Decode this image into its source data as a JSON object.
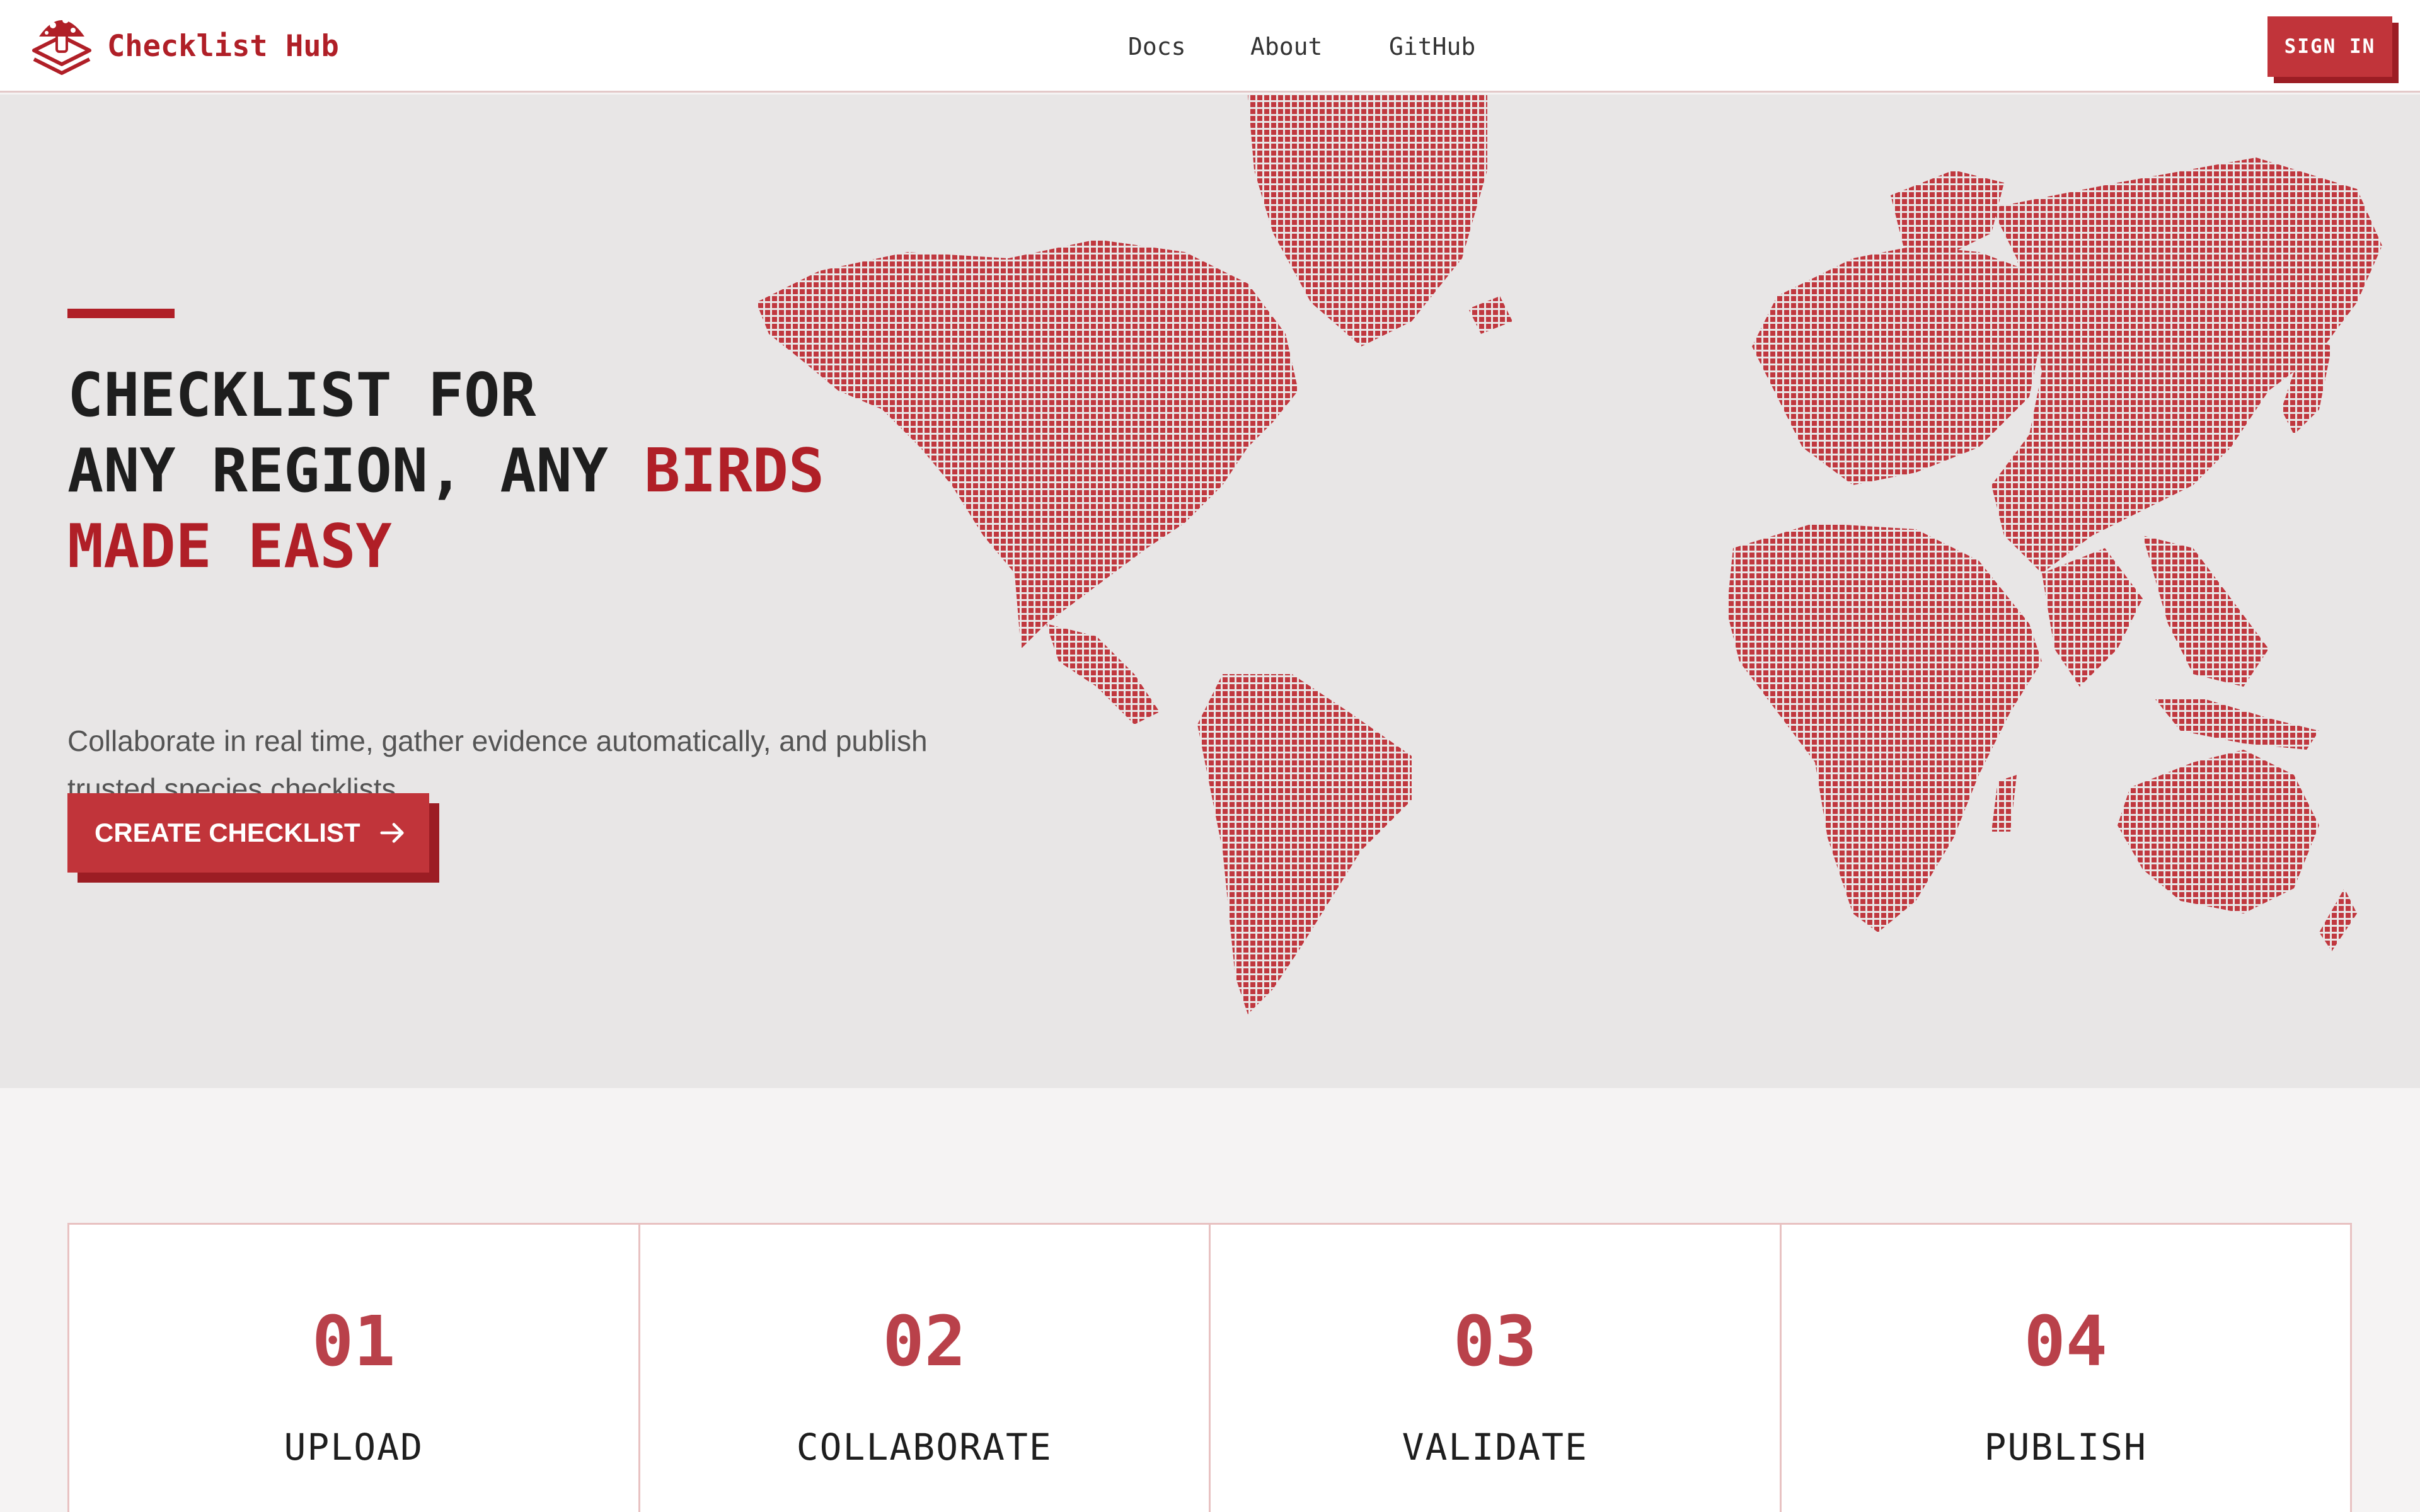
{
  "header": {
    "brand": "Checklist Hub",
    "nav": [
      {
        "label": "Docs"
      },
      {
        "label": "About"
      },
      {
        "label": "GitHub"
      }
    ],
    "signin_label": "SIGN IN"
  },
  "hero": {
    "headline_line1": "CHECKLIST FOR",
    "headline_line2_plain": "ANY REGION, ANY ",
    "headline_line2_accent": "BIRDS",
    "headline_line3": "MADE EASY",
    "subtitle": "Collaborate in real time, gather evidence automatically, and publish trusted species checklists.",
    "cta_label": "CREATE CHECKLIST"
  },
  "steps": [
    {
      "number": "01",
      "label": "UPLOAD"
    },
    {
      "number": "02",
      "label": "COLLABORATE"
    },
    {
      "number": "03",
      "label": "VALIDATE"
    },
    {
      "number": "04",
      "label": "PUBLISH"
    }
  ],
  "colors": {
    "accent": "#b01f27",
    "button": "#c1343a",
    "button_shadow": "#9c1d24",
    "map_dot": "#c0383f",
    "hero_bg": "#e8e6e6"
  }
}
